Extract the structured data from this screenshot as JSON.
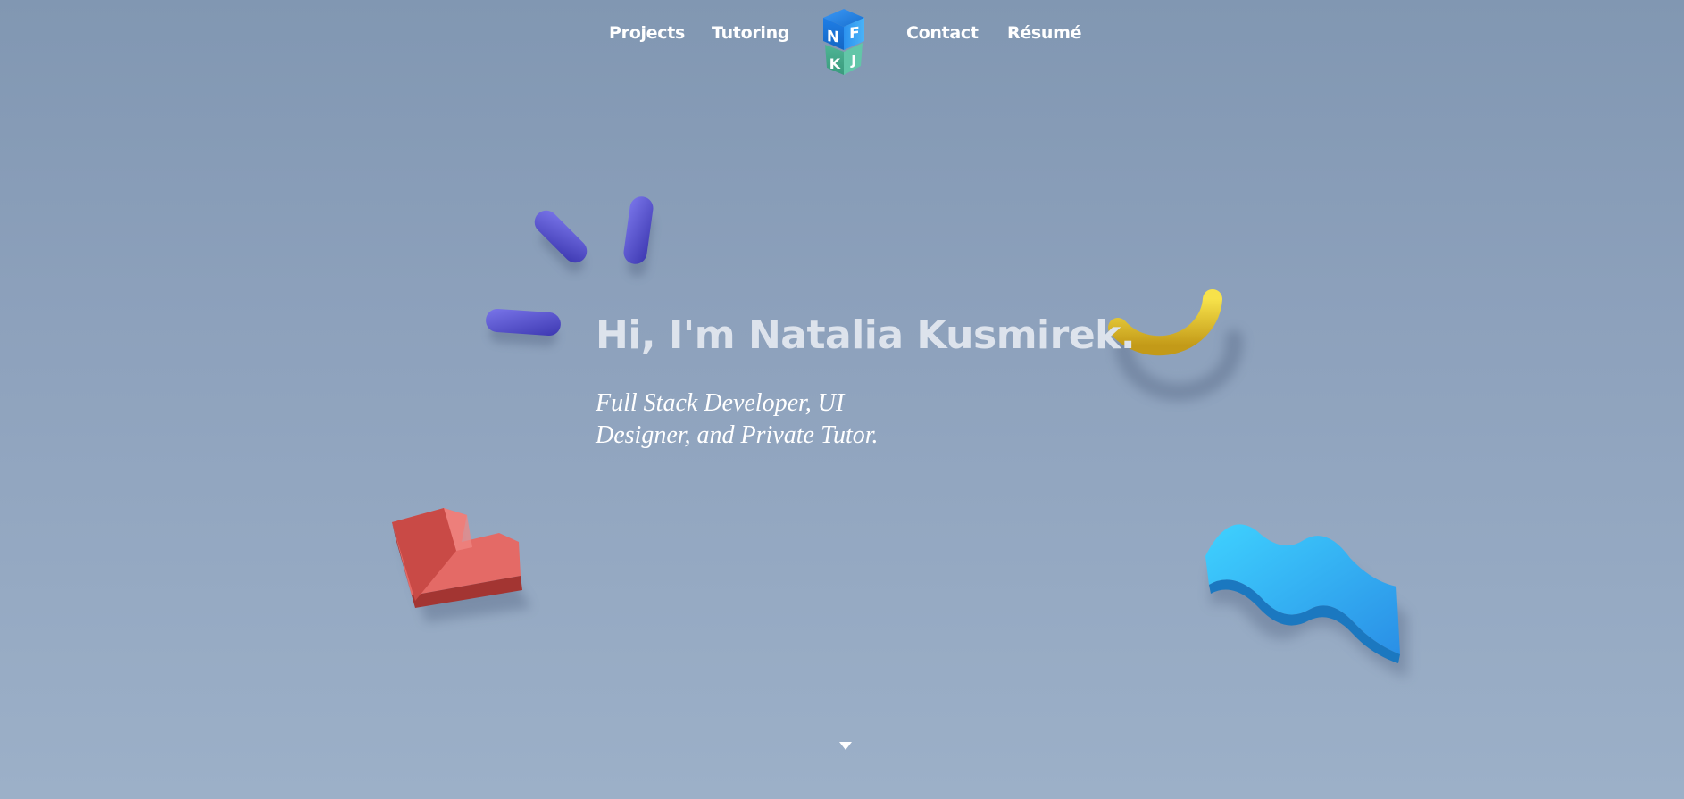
{
  "nav": {
    "projects": "Projects",
    "tutoring": "Tutoring",
    "contact": "Contact",
    "resume": "Résumé",
    "logo": {
      "letters": [
        "N",
        "F",
        "K",
        "J"
      ],
      "colors": {
        "top": "#1e7fe0",
        "front": "#2d8df0",
        "side": "#3fa9f5",
        "bottom": "#41a88a",
        "bottom_side": "#5fc3a5"
      }
    }
  },
  "hero": {
    "title": "Hi, I'm Natalia Kusmirek.",
    "subtitle": "Full Stack Developer, UI Designer, and Private Tutor."
  },
  "decorations": {
    "pills": {
      "color": "#5a56d6",
      "icon": "purple-pills"
    },
    "arc": {
      "color": "#e2c02a",
      "icon": "yellow-arc"
    },
    "l_block": {
      "color": "#c8403e",
      "icon": "red-l-block"
    },
    "wave": {
      "color": "#38b4f0",
      "icon": "blue-wave"
    }
  },
  "scroll": {
    "icon": "chevron-down-icon"
  }
}
